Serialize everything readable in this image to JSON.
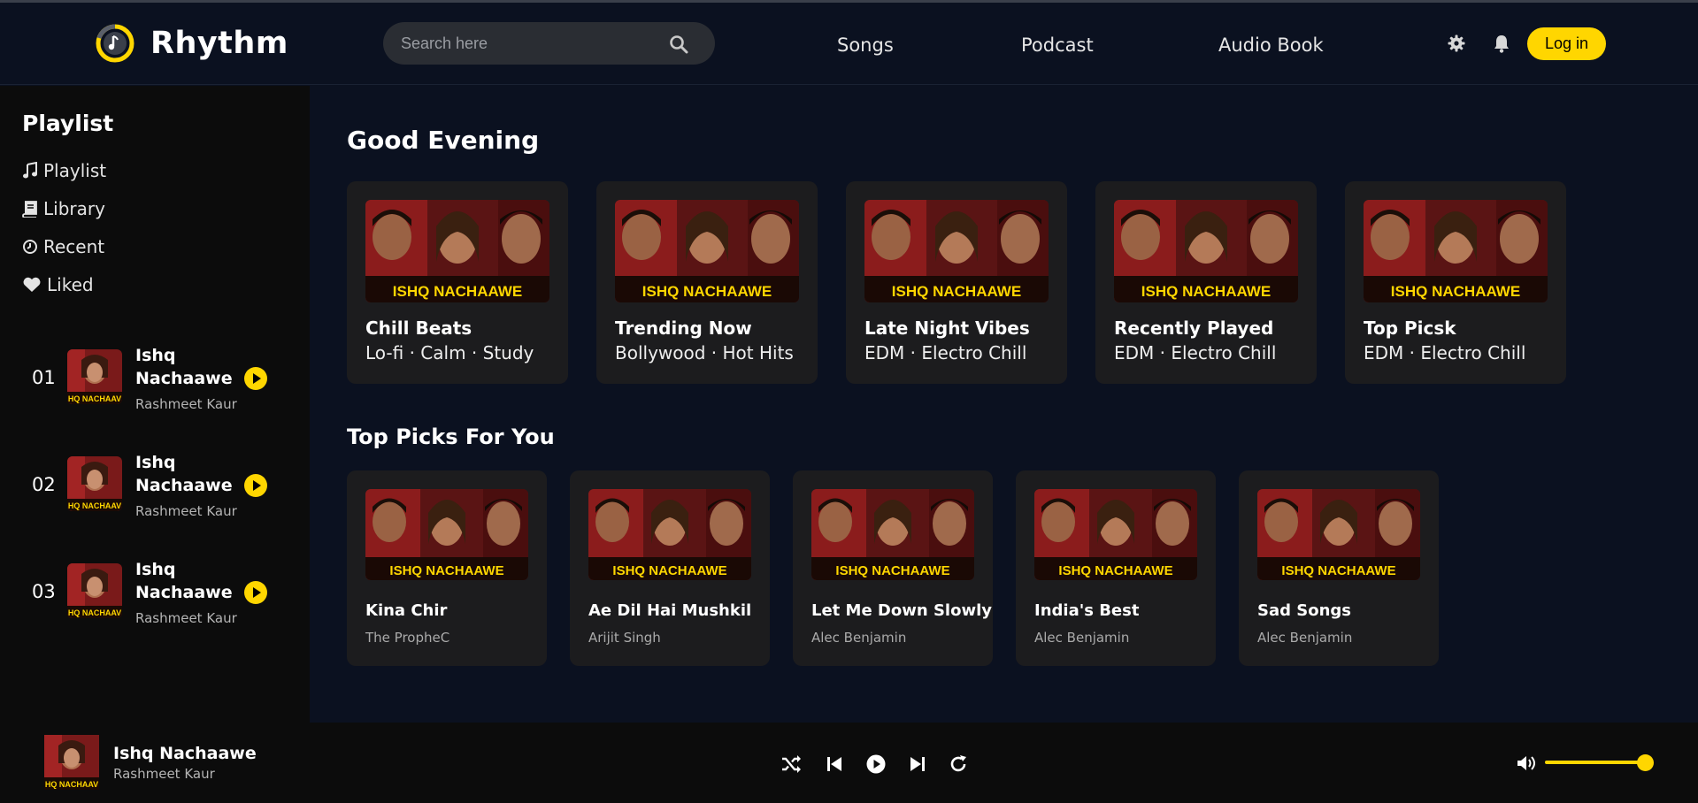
{
  "header": {
    "app_name": "Rhythm",
    "search_placeholder": "Search here",
    "nav": [
      "Songs",
      "Podcast",
      "Audio Book"
    ],
    "login_label": "Log in"
  },
  "sidebar": {
    "title": "Playlist",
    "items": [
      {
        "label": "Playlist",
        "icon": "music-note-icon"
      },
      {
        "label": "Library",
        "icon": "book-icon"
      },
      {
        "label": "Recent",
        "icon": "clock-icon"
      },
      {
        "label": "Liked",
        "icon": "heart-icon"
      }
    ],
    "tracks": [
      {
        "num": "01",
        "title": "Ishq Nachaawe",
        "artist": "Rashmeet Kaur"
      },
      {
        "num": "02",
        "title": "Ishq Nachaawe",
        "artist": "Rashmeet Kaur"
      },
      {
        "num": "03",
        "title": "Ishq Nachaawe",
        "artist": "Rashmeet Kaur"
      }
    ]
  },
  "main": {
    "greeting": "Good Evening",
    "playlists": [
      {
        "title": "Chill Beats",
        "subtitle": "Lo-fi · Calm · Study"
      },
      {
        "title": "Trending Now",
        "subtitle": "Bollywood · Hot Hits"
      },
      {
        "title": "Late Night Vibes",
        "subtitle": "EDM · Electro Chill"
      },
      {
        "title": "Recently Played",
        "subtitle": "EDM · Electro Chill"
      },
      {
        "title": "Top Picsk",
        "subtitle": "EDM · Electro Chill"
      }
    ],
    "top_picks_title": "Top Picks For You",
    "top_picks": [
      {
        "title": "Kina Chir",
        "artist": "The PropheC"
      },
      {
        "title": "Ae Dil Hai Mushkil",
        "artist": "Arijit Singh"
      },
      {
        "title": "Let Me Down Slowly",
        "artist": "Alec Benjamin"
      },
      {
        "title": "India's Best",
        "artist": "Alec Benjamin"
      },
      {
        "title": "Sad Songs",
        "artist": "Alec Benjamin"
      }
    ],
    "cover_text": "ISHQ NACHAAWE"
  },
  "player": {
    "title": "Ishq Nachaawe",
    "artist": "Rashmeet Kaur",
    "volume": 0.92
  },
  "colors": {
    "accent": "#ffd600",
    "background": "#0b1120",
    "sidebar": "#0c0c0c",
    "card": "#1c1c1e"
  }
}
